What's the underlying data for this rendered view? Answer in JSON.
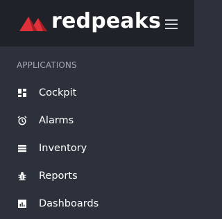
{
  "header": {
    "brand": "redpeaks",
    "menu_icon": "hamburger-menu-icon"
  },
  "sidebar": {
    "section_title": "APPLICATIONS",
    "items": [
      {
        "label": "Cockpit",
        "icon": "dashboard-grid-icon"
      },
      {
        "label": "Alarms",
        "icon": "alarm-clock-icon"
      },
      {
        "label": "Inventory",
        "icon": "list-icon"
      },
      {
        "label": "Reports",
        "icon": "bug-icon"
      },
      {
        "label": "Dashboards",
        "icon": "bar-chart-icon"
      }
    ]
  },
  "colors": {
    "topbar_bg": "#1f2228",
    "sidebar_bg": "#2d313b",
    "brand_red": "#e0303a",
    "brand_red_dark": "#a11f27",
    "text_primary": "#ffffff",
    "text_muted": "#a3a8b3"
  }
}
